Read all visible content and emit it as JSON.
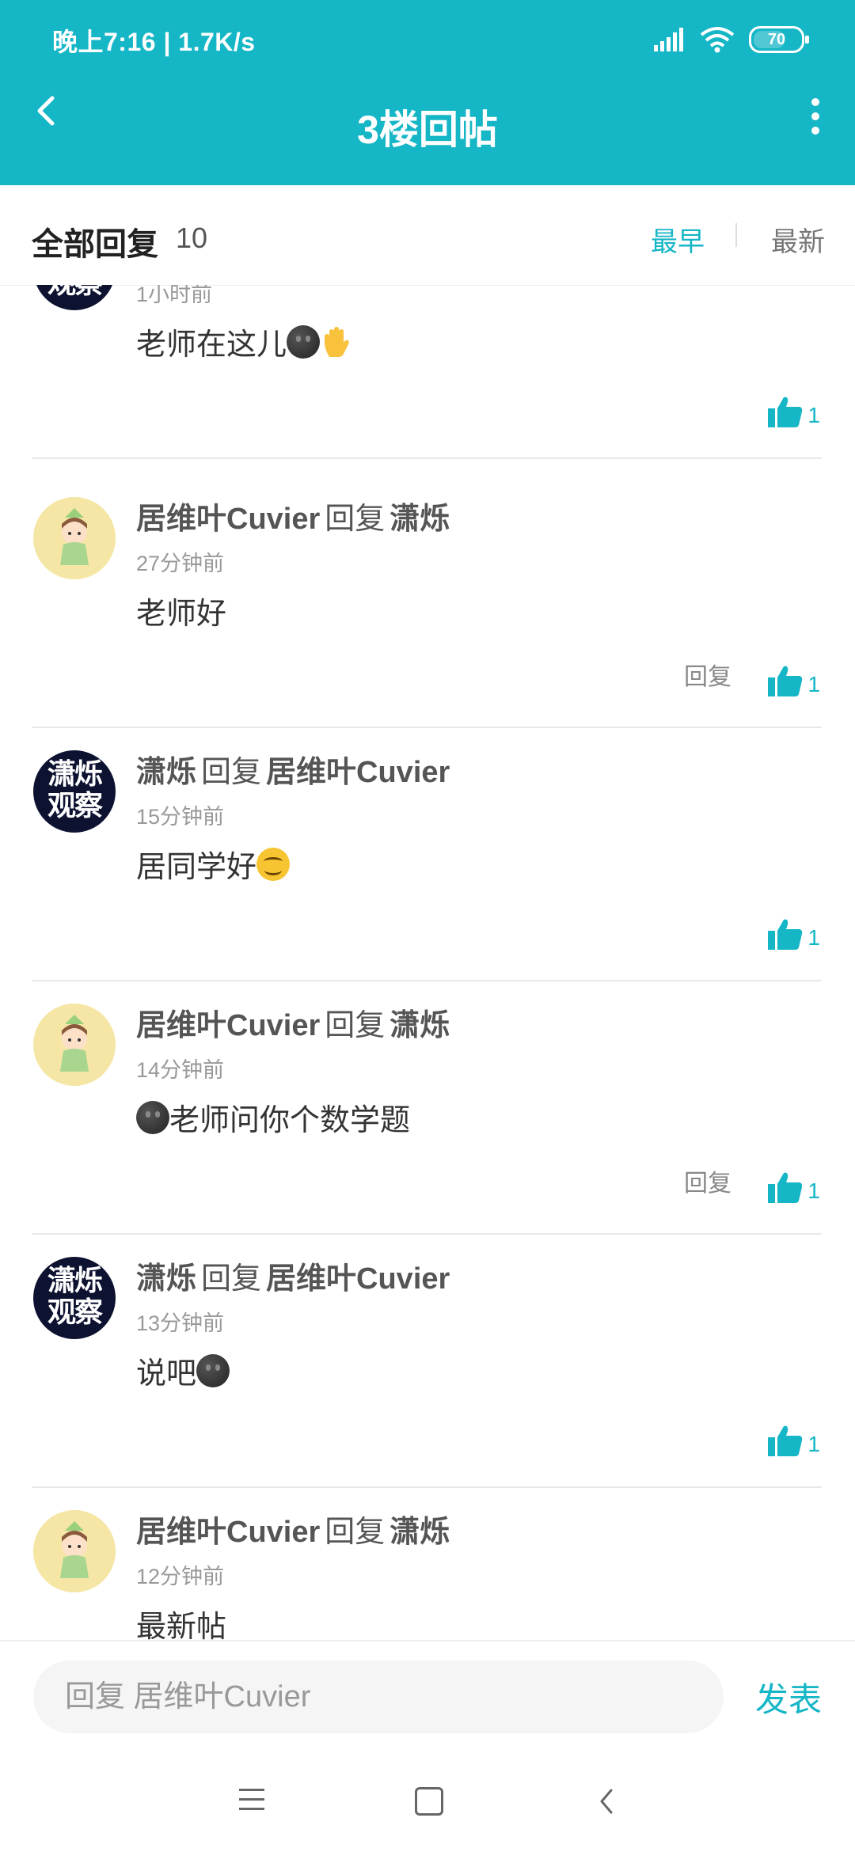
{
  "status_bar": {
    "time": "晚上7:16 | 1.7K/s",
    "battery": "70",
    "battery_level": 0.7,
    "icons": [
      "signal-icon",
      "wifi-icon",
      "battery-icon"
    ]
  },
  "header": {
    "title": "3楼回帖",
    "back_icon": "back-arrow-icon",
    "more_icon": "more-vertical-icon"
  },
  "subheader": {
    "all_replies_label": "全部回复",
    "count": "10",
    "sort_earliest": "最早",
    "sort_newest": "最新"
  },
  "comments": [
    {
      "time": "1小时前",
      "text": "老师在这儿",
      "likes": "1"
    },
    {
      "user": "居维叶Cuvier",
      "reply_word": "回复",
      "to": "潇烁",
      "time": "27分钟前",
      "text": "老师好",
      "reply_label": "回复",
      "likes": "1"
    },
    {
      "user": "潇烁",
      "reply_word": "回复",
      "to": "居维叶Cuvier",
      "time": "15分钟前",
      "text": "居同学好",
      "likes": "1"
    },
    {
      "user": "居维叶Cuvier",
      "reply_word": "回复",
      "to": "潇烁",
      "time": "14分钟前",
      "text": "老师问你个数学题",
      "reply_label": "回复",
      "likes": "1"
    },
    {
      "user": "潇烁",
      "reply_word": "回复",
      "to": "居维叶Cuvier",
      "time": "13分钟前",
      "text": "说吧",
      "likes": "1"
    },
    {
      "user": "居维叶Cuvier",
      "reply_word": "回复",
      "to": "潇烁",
      "time": "12分钟前",
      "text": "最新帖"
    }
  ],
  "avatar_dark": {
    "line1": "潇烁",
    "line2": "观察"
  },
  "reply_bar": {
    "placeholder": "回复 居维叶Cuvier",
    "send_label": "发表"
  },
  "colors": {
    "accent": "#15b6c6",
    "header_bg": "#15b6c6"
  }
}
